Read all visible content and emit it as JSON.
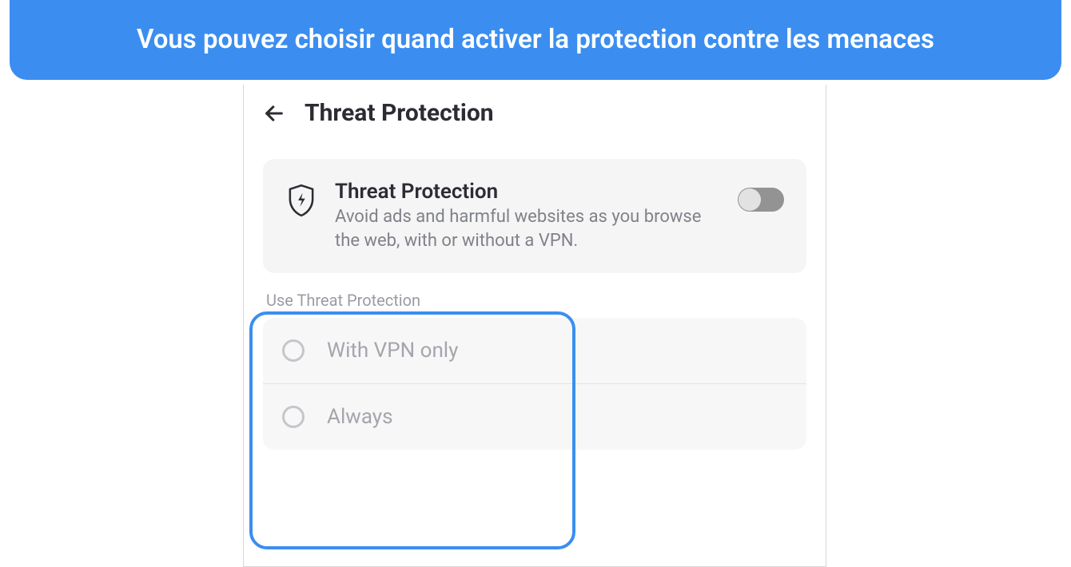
{
  "banner": {
    "text": "Vous pouvez choisir quand activer la protection contre les menaces"
  },
  "panel": {
    "title": "Threat Protection"
  },
  "card": {
    "title": "Threat Protection",
    "subtitle": "Avoid ads and harmful websites as you browse the web, with or without a VPN.",
    "toggle_on": false
  },
  "section": {
    "label": "Use Threat Protection",
    "options": [
      "With VPN only",
      "Always"
    ]
  },
  "colors": {
    "accent": "#3b8ef0"
  }
}
